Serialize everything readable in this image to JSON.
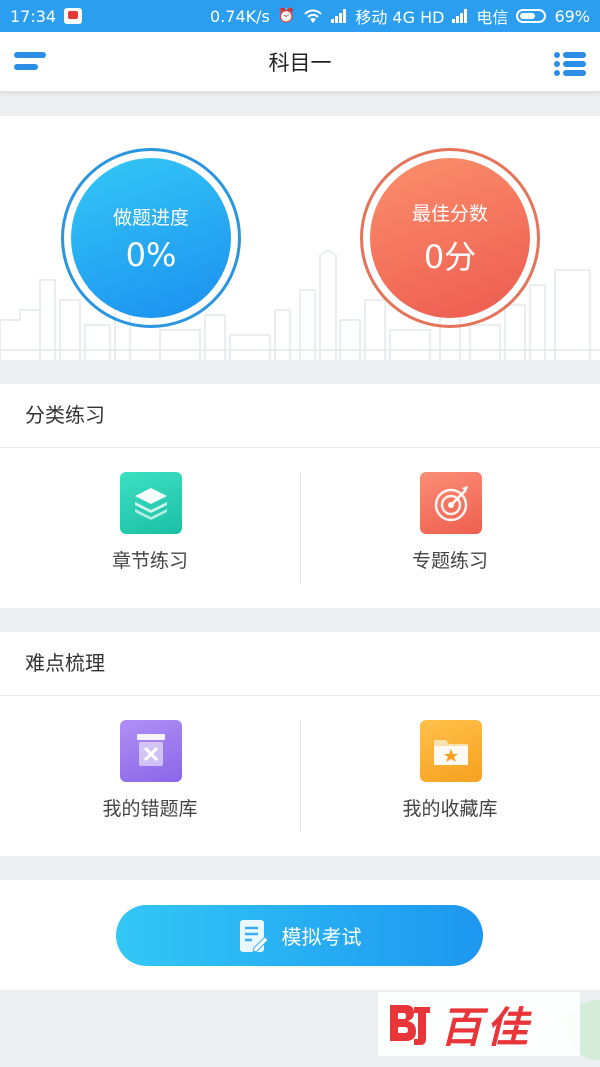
{
  "status_bar": {
    "time": "17:34",
    "net_speed": "0.74K/s",
    "carrier1": "移动 4G HD",
    "carrier2": "电信",
    "battery": "69%",
    "battery_level": 0.69
  },
  "header": {
    "title": "科目一",
    "accent": "#2b8de6"
  },
  "stats": {
    "progress": {
      "label": "做题进度",
      "value": "0%"
    },
    "best_score": {
      "label": "最佳分数",
      "value": "0分"
    }
  },
  "category_practice": {
    "title": "分类练习",
    "items": [
      {
        "label": "章节练习",
        "icon": "layers-icon",
        "color": "#22c7ab"
      },
      {
        "label": "专题练习",
        "icon": "target-icon",
        "color": "#f06a56"
      }
    ]
  },
  "difficult_review": {
    "title": "难点梳理",
    "items": [
      {
        "label": "我的错题库",
        "icon": "wrong-box-icon",
        "color": "#9272ec"
      },
      {
        "label": "我的收藏库",
        "icon": "star-folder-icon",
        "color": "#f8ac2c"
      }
    ]
  },
  "exam_button": {
    "label": "模拟考试",
    "icon": "document-edit-icon"
  },
  "watermark": {
    "text": "百佳"
  }
}
